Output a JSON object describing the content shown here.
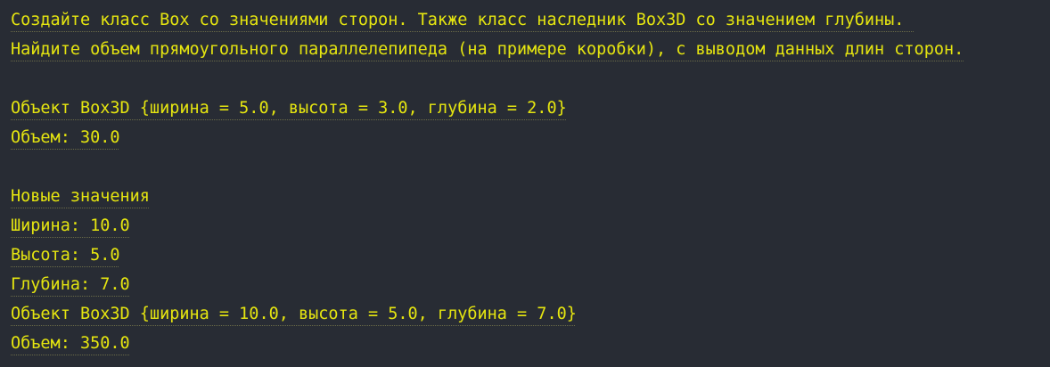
{
  "console": {
    "text_color": "#e5e510",
    "background_color": "#282c34",
    "lines": [
      "Создайте класс Box со значениями сторон. Также класс наследник Box3D со значением глубины. ",
      "Найдите объем прямоугольного параллелепипеда (на примере коробки), с выводом данных длин сторон.",
      "",
      "Объект Box3D {ширина = 5.0, высота = 3.0, глубина = 2.0}",
      "Объем: 30.0",
      "",
      "Новые значения",
      "Ширина: 10.0",
      "Высота: 5.0",
      "Глубина: 7.0",
      "Объект Box3D {ширина = 10.0, высота = 5.0, глубина = 7.0}",
      "Объем: 350.0"
    ]
  }
}
